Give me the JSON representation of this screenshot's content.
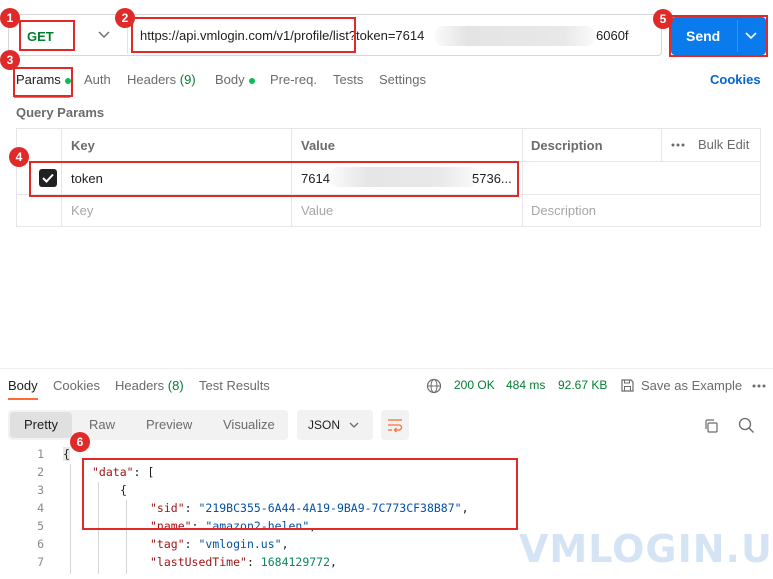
{
  "request": {
    "method": "GET",
    "url_visible_start": "https://api.vmlogin.com/v1/profile/list?token=7614",
    "url_visible_end": "6060f",
    "send_label": "Send"
  },
  "request_tabs": [
    {
      "label": "Params",
      "dot": true
    },
    {
      "label": "Auth"
    },
    {
      "label": "Headers",
      "count": "(9)"
    },
    {
      "label": "Body",
      "dot": true
    },
    {
      "label": "Pre-req."
    },
    {
      "label": "Tests"
    },
    {
      "label": "Settings"
    }
  ],
  "cookies_label": "Cookies",
  "query_params": {
    "title": "Query Params",
    "columns": {
      "key": "Key",
      "value": "Value",
      "description": "Description",
      "bulk_edit": "Bulk Edit"
    },
    "rows": [
      {
        "checked": true,
        "key": "token",
        "value_start": "7614",
        "value_end": "5736..."
      }
    ],
    "placeholder": {
      "key": "Key",
      "value": "Value",
      "description": "Description"
    }
  },
  "response": {
    "tabs": [
      {
        "label": "Body",
        "active": true
      },
      {
        "label": "Cookies"
      },
      {
        "label": "Headers",
        "count": "(8)"
      },
      {
        "label": "Test Results"
      }
    ],
    "status": "200 OK",
    "time": "484 ms",
    "size": "92.67 KB",
    "save_example": "Save as Example",
    "formats": [
      "Pretty",
      "Raw",
      "Preview",
      "Visualize"
    ],
    "active_format": "Pretty",
    "language": "JSON",
    "code_lines": [
      {
        "n": "1",
        "text": "{"
      },
      {
        "n": "2",
        "key": "\"data\"",
        "rest": ": ["
      },
      {
        "n": "3",
        "text": "{"
      },
      {
        "n": "4",
        "key": "\"sid\"",
        "value": "\"219BC355-6A44-4A19-9BA9-7C773CF38B87\"",
        "rest": ","
      },
      {
        "n": "5",
        "key": "\"name\"",
        "value": "\"amazon2-helen\"",
        "rest": ","
      },
      {
        "n": "6",
        "key": "\"tag\"",
        "value": "\"vmlogin.us\"",
        "rest": ","
      },
      {
        "n": "7",
        "key": "\"lastUsedTime\"",
        "number": "1684129772",
        "rest": ","
      }
    ]
  },
  "annotations": [
    "1",
    "2",
    "3",
    "4",
    "5",
    "6"
  ],
  "watermark": "VMLOGIN.US",
  "colors": {
    "accent": "#ff6c37",
    "send": "#097bed",
    "method": "#007f31",
    "annotation": "#e02a2a",
    "link": "#0265d2"
  }
}
